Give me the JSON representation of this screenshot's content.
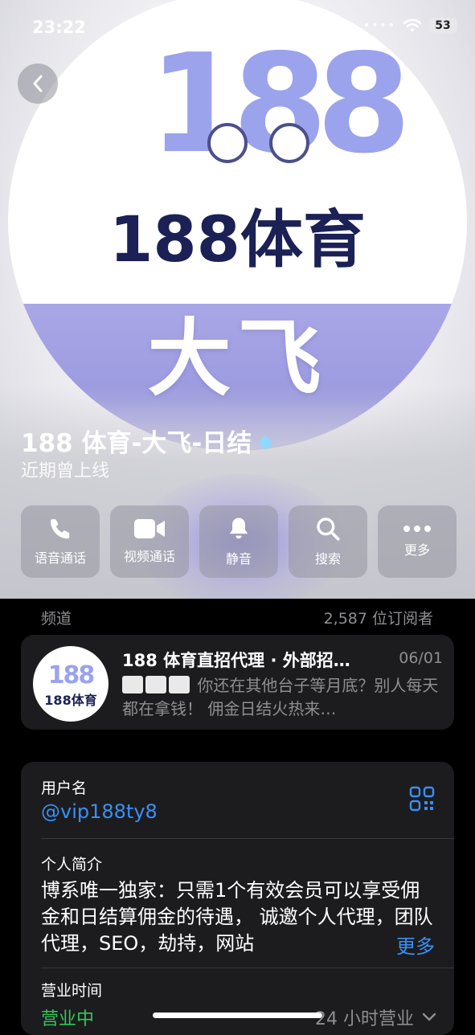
{
  "status_bar": {
    "time": "23:22",
    "signal_dots": "••••",
    "battery": "53"
  },
  "hero": {
    "logo_number": "188",
    "logo_text": "188体育",
    "logo_banner": "大飞"
  },
  "profile": {
    "name": "188 体育-大飞-日结",
    "badge_icon": "diamond-icon",
    "status": "近期曾上线"
  },
  "actions": [
    {
      "label": "语音通话",
      "icon": "phone-icon"
    },
    {
      "label": "视频通话",
      "icon": "video-icon"
    },
    {
      "label": "静音",
      "icon": "bell-icon"
    },
    {
      "label": "搜索",
      "icon": "search-icon"
    },
    {
      "label": "更多",
      "icon": "more-icon"
    }
  ],
  "channel_section": {
    "title": "频道",
    "subscribers": "2,587 位订阅者"
  },
  "channel": {
    "avatar_number": "188",
    "avatar_text": "188体育",
    "title": "188 体育直招代理 · 外部招…",
    "date": "06/01",
    "preview": "你还在其他台子等月底？别人每天都在拿钱！ 佣金日结火热来…"
  },
  "info": {
    "username_label": "用户名",
    "username": "@vip188ty8",
    "bio_label": "个人简介",
    "bio": "博系唯一独家：只需1个有效会员可以享受佣金和日结算佣金的待遇， 诚邀个人代理，团队代理，SEO，劫持，网站",
    "bio_more": "更多",
    "hours_label": "营业时间",
    "open_status": "营业中",
    "hours_value": "24 小时营业"
  },
  "colors": {
    "accent": "#3a8ff7",
    "open_green": "#34c759",
    "card_bg": "#1c1c1e"
  }
}
